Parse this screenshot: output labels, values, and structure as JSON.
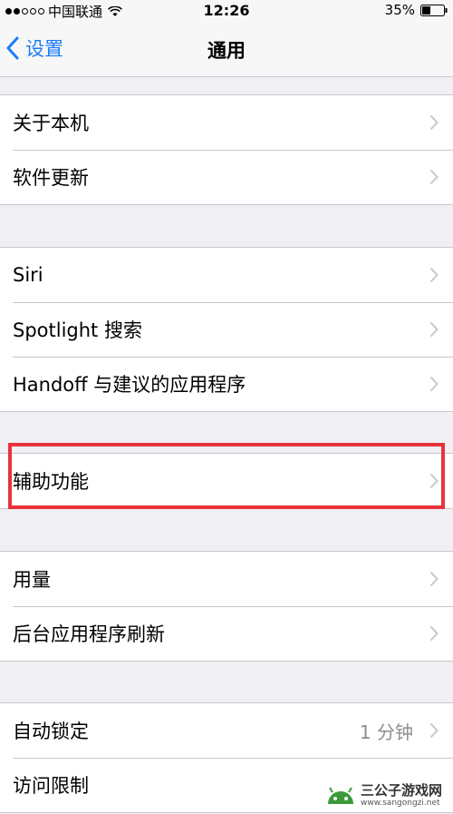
{
  "status_bar": {
    "carrier": "中国联通",
    "time": "12:26",
    "battery": "35%"
  },
  "nav": {
    "back_label": "设置",
    "title": "通用"
  },
  "groups": [
    {
      "items": [
        {
          "label": "关于本机"
        },
        {
          "label": "软件更新"
        }
      ]
    },
    {
      "items": [
        {
          "label": "Siri"
        },
        {
          "label": "Spotlight 搜索"
        },
        {
          "label": "Handoff 与建议的应用程序"
        }
      ]
    },
    {
      "items": [
        {
          "label": "辅助功能"
        }
      ]
    },
    {
      "items": [
        {
          "label": "用量"
        },
        {
          "label": "后台应用程序刷新"
        }
      ]
    },
    {
      "items": [
        {
          "label": "自动锁定",
          "value": "1 分钟"
        },
        {
          "label": "访问限制"
        }
      ]
    }
  ],
  "colors": {
    "accent": "#1a7cf9",
    "highlight": "#e8333b",
    "background": "#efeff4"
  },
  "watermark": {
    "title": "三公子游戏网",
    "url": "www.sangongzi.net"
  }
}
